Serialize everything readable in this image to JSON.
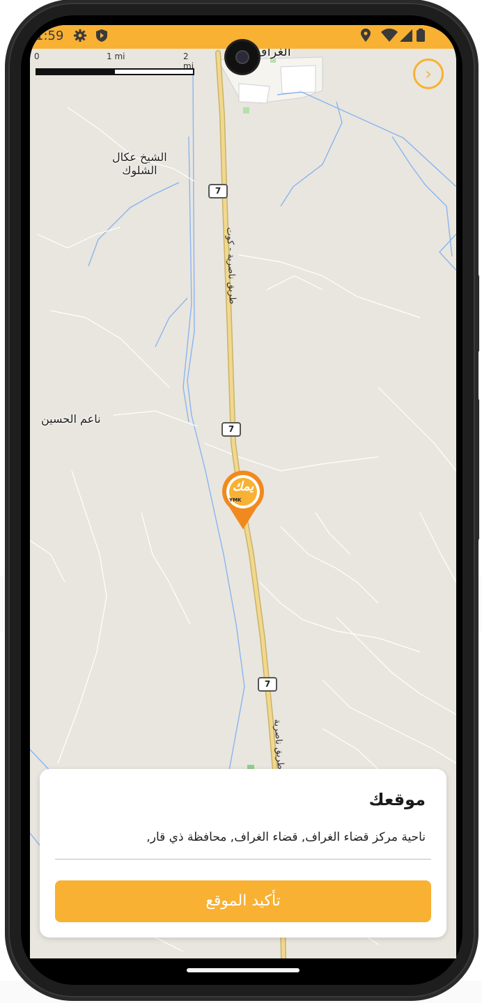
{
  "status_bar": {
    "time": "1:59",
    "background_color": "#f8b133",
    "left_icons": [
      "settings-gear-icon",
      "shield-icon"
    ],
    "right_icons": [
      "location-pin-icon",
      "wifi-icon",
      "signal-icon",
      "battery-icon"
    ]
  },
  "map": {
    "scale": {
      "zero": "0",
      "mid": "1 mi",
      "end": "2 mi"
    },
    "place_labels": {
      "top_town": "الغراف",
      "sheikh_line1": "الشيخ عكال",
      "sheikh_line2": "الشلوك",
      "naem": "ناعم الحسين"
    },
    "road_number": "7",
    "road_name_upper": "طريق ناصرية - كوت",
    "road_name_lower": "طريق ناصرية"
  },
  "marker": {
    "brand_text": "يمك",
    "brand_subtext": "YMK",
    "color": "#f08a1e"
  },
  "location_card": {
    "title": "موقعك",
    "address": "ناحية مركز قضاء الغراف, قضاء الغراف, محافظة ذي قار,",
    "confirm_label": "تأكيد الموقع",
    "accent_color": "#f8b133"
  }
}
